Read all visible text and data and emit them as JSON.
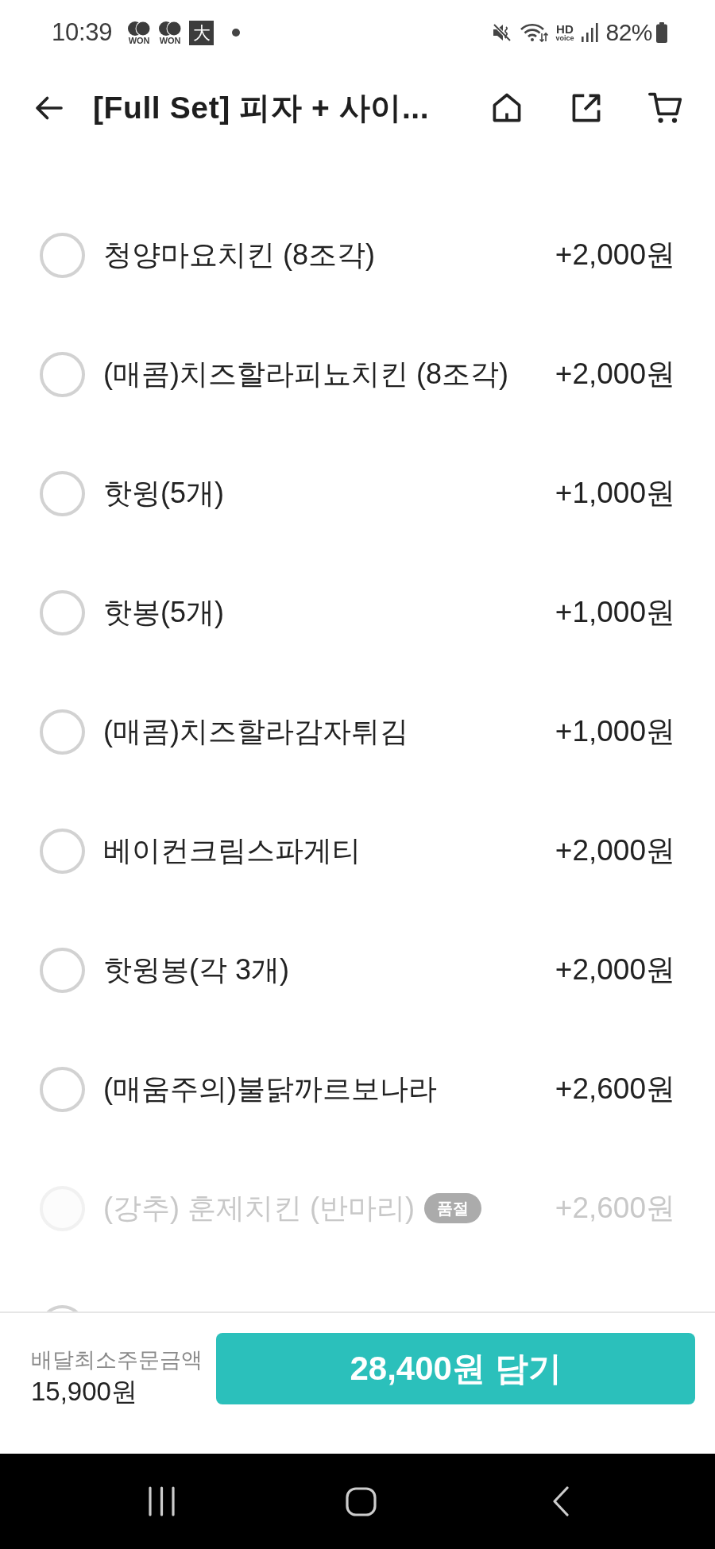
{
  "status_bar": {
    "time": "10:39",
    "notifications": [
      {
        "kind": "coins",
        "label": "WON"
      },
      {
        "kind": "coins",
        "label": "WON"
      },
      {
        "kind": "glyph",
        "label": "大"
      },
      {
        "kind": "dot"
      }
    ],
    "hd_label": "HD",
    "voice_label": "voice",
    "battery": "82%"
  },
  "header": {
    "title": "[Full Set] 피자 + 사이..."
  },
  "options": [
    {
      "name": "청양마요치킨 (8조각)",
      "price": "+2,000원",
      "selected": false,
      "disabled": false
    },
    {
      "name": "(매콤)치즈할라피뇨치킨 (8조각)",
      "price": "+2,000원",
      "selected": false,
      "disabled": false
    },
    {
      "name": "핫윙(5개)",
      "price": "+1,000원",
      "selected": false,
      "disabled": false
    },
    {
      "name": "핫봉(5개)",
      "price": "+1,000원",
      "selected": false,
      "disabled": false
    },
    {
      "name": "(매콤)치즈할라감자튀김",
      "price": "+1,000원",
      "selected": false,
      "disabled": false
    },
    {
      "name": "베이컨크림스파게티",
      "price": "+2,000원",
      "selected": false,
      "disabled": false
    },
    {
      "name": "핫윙봉(각 3개)",
      "price": "+2,000원",
      "selected": false,
      "disabled": false
    },
    {
      "name": "(매움주의)불닭까르보나라",
      "price": "+2,600원",
      "selected": false,
      "disabled": false
    },
    {
      "name": "(강추) 훈제치킨 (반마리)",
      "badge": "품절",
      "price": "+2,600원",
      "selected": false,
      "disabled": true
    },
    {
      "selected": false,
      "disabled": false
    }
  ],
  "footer": {
    "minimum_label": "배달최소주문금액",
    "minimum_amount": "15,900원",
    "add_button": "28,400원 담기"
  }
}
